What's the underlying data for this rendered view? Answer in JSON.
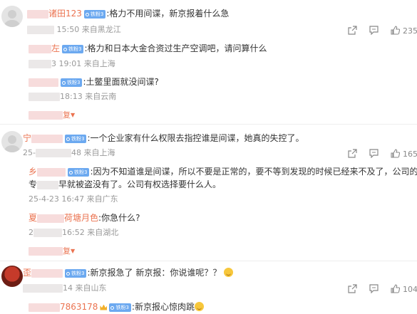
{
  "labels": {
    "reply_more": "复"
  },
  "icon_names": [
    "share-icon",
    "comment-icon",
    "like-icon",
    "badge-dot-icon",
    "caret-down-icon",
    "emoji-laugh-icon",
    "crown-icon"
  ],
  "comments": [
    {
      "id": "c1",
      "user_suffix": "诸田123",
      "badge": "铁粉3",
      "text": ":格力不用间谍，新京报着什么急",
      "time": "15:50",
      "location": "来自黑龙江",
      "likes": "235",
      "replies": [
        {
          "user_suffix": "左",
          "badge": "铁粉3",
          "text": ":格力和日本大金合资过生产空调吧，请问算什么",
          "time": "3 19:01",
          "location": "来自上海"
        },
        {
          "user_suffix": "",
          "badge": "铁粉3",
          "text": ":土鳖里面就没间谍?",
          "time": "18:13",
          "location": "来自云南"
        }
      ]
    },
    {
      "id": "c2",
      "user_prefix": "宁",
      "badge": "铁粉3",
      "text": ":一个企业家有什么权限去指控谁是间谍，她真的失控了。",
      "time_prefix": "25-",
      "time": "48",
      "location": "来自上海",
      "likes": "165",
      "replies": [
        {
          "user_prefix": "乡",
          "badge": "铁粉3",
          "text_line1": ":因为不知道谁是间谍，所以不要是正常的，要不等到发现的时候已经来不及了，公司的",
          "text_line2_prefix": "专",
          "text_line2": "早就被盗没有了。公司有权选择要什么人。",
          "time": "25-4-23 16:47",
          "location": "来自广东"
        },
        {
          "user_prefix": "夏",
          "user_suffix": "荷塘月色",
          "text": ":你急什么?",
          "time_prefix": "2",
          "time": "16:52",
          "location": "来自湖北"
        }
      ]
    },
    {
      "id": "c3",
      "user_prefix": "歪",
      "badge": "铁粉3",
      "text": ":新京报急了 新京报：你说谁呢？？",
      "time": "14",
      "location": "来自山东",
      "likes": "104",
      "replies": [
        {
          "user_suffix": "7863178",
          "badge": "铁粉3",
          "text": ":新京报心惊肉跳"
        }
      ]
    }
  ]
}
